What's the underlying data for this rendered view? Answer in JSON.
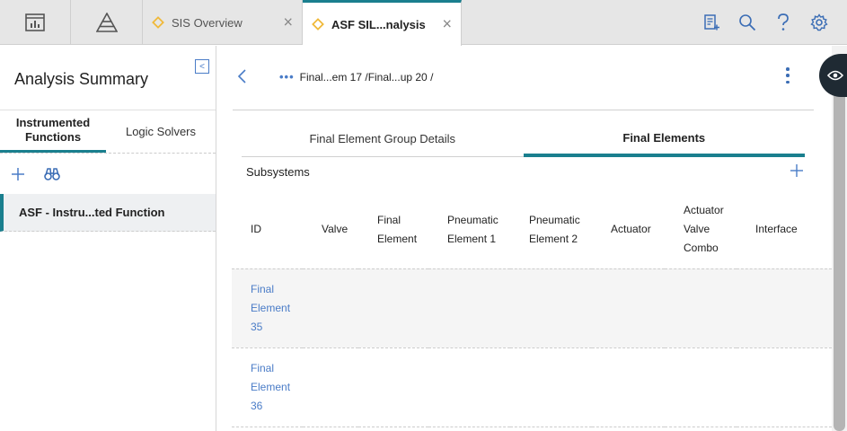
{
  "topbar": {
    "tabs": [
      {
        "label": "SIS Overview",
        "close": "×"
      },
      {
        "label": "ASF SIL...nalysis",
        "close": "×"
      }
    ]
  },
  "left_panel": {
    "title": "Analysis Summary",
    "tabs": [
      "Instrumented Functions",
      "Logic Solvers"
    ],
    "selected_item": "ASF - Instru...ted Function",
    "collapse_glyph": "<"
  },
  "main": {
    "breadcrumb": "Final...em 17 /Final...up 20 /",
    "breadcrumb_dots": "•••",
    "tabs": [
      "Final Element Group Details",
      "Final Elements"
    ],
    "section_title": "Subsystems",
    "table": {
      "columns": [
        "ID",
        "Valve",
        "Final Element",
        "Pneumatic Element 1",
        "Pneumatic Element 2",
        "Actuator",
        "Actuator Valve Combo",
        "Interface"
      ],
      "rows": [
        {
          "id": "Final Element 35"
        },
        {
          "id": "Final Element 36"
        }
      ]
    }
  },
  "colors": {
    "accent": "#1a7f8e",
    "link": "#4a7cc7",
    "tab_diamond": "#f0b93a"
  }
}
